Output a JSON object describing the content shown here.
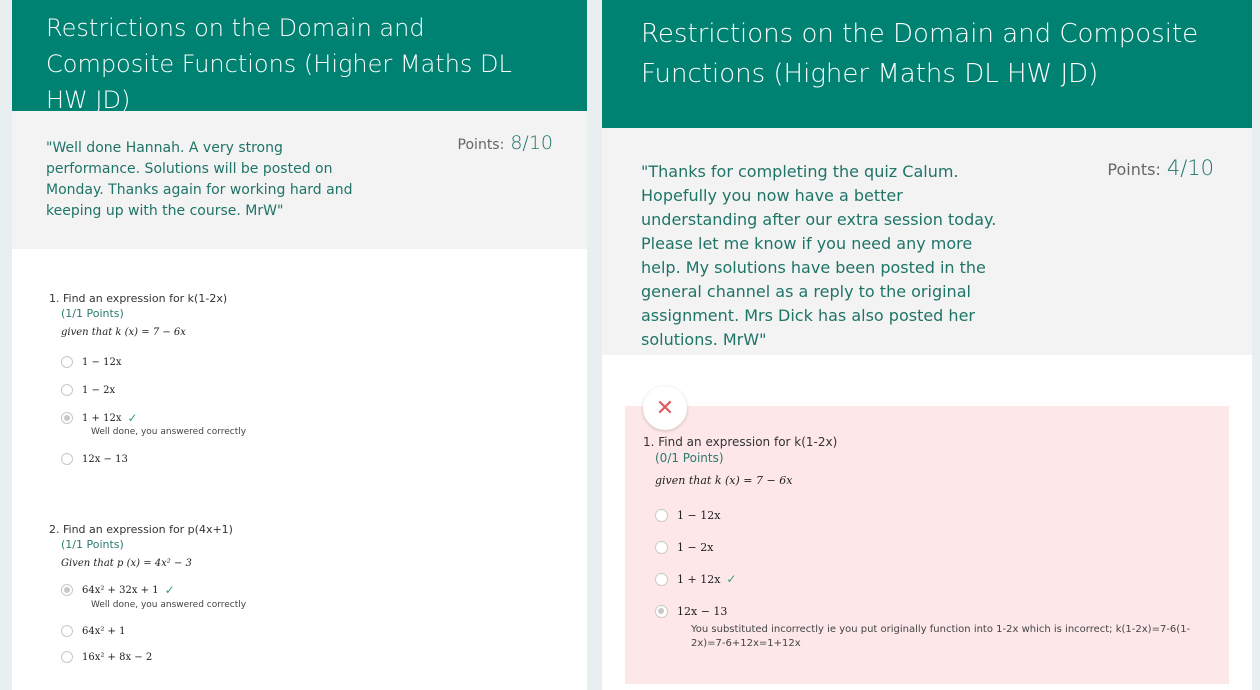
{
  "left": {
    "title": "Restrictions on the Domain and Composite Functions (Higher Maths DL HW JD)",
    "feedback": "\"Well done Hannah. A very strong performance. Solutions will be posted on Monday. Thanks again for working hard and keeping up with the course. MrW\"",
    "points_label": "Points:",
    "points_value": "8/10",
    "q1": {
      "title": "1. Find an expression for k(1-2x)",
      "points": "(1/1 Points)",
      "given": "given that k (x) = 7 − 6x",
      "options": [
        "1 − 12x",
        "1 − 2x",
        "1 + 12x",
        "12x − 13"
      ],
      "feedback": "Well done, you answered correctly"
    },
    "q2": {
      "title": "2. Find an expression for p(4x+1)",
      "points": "(1/1 Points)",
      "given": "Given that  p (x)  =  4x² − 3",
      "options": [
        "64x² + 32x + 1",
        "64x² + 1",
        "16x² + 8x − 2"
      ],
      "feedback": "Well done, you answered correctly"
    }
  },
  "right": {
    "title": "Restrictions on the Domain and Composite Functions (Higher Maths DL HW JD)",
    "feedback": "\"Thanks for completing the quiz Calum. Hopefully you now have a better understanding after our extra session today. Please let me know if you need any more help. My solutions have been posted in the general channel as a reply to the original assignment. Mrs Dick has also posted her solutions. MrW\"",
    "points_label": "Points:",
    "points_value": "4/10",
    "q1": {
      "title": "1. Find an expression for k(1-2x)",
      "points": "(0/1 Points)",
      "given": "given that k (x) = 7 − 6x",
      "options": [
        "1 − 12x",
        "1 − 2x",
        "1 + 12x",
        "12x − 13"
      ],
      "feedback": "You substituted incorrectly ie you put originally function into 1-2x which is incorrect; k(1-2x)=7-6(1-2x)=7-6+12x=1+12x"
    }
  },
  "icons": {
    "check": "✓",
    "wrong": "✕"
  },
  "colors": {
    "header": "#008272",
    "feedback_text": "#1f7468",
    "incorrect_bg": "#fde7e9",
    "check": "#3aa16f"
  }
}
